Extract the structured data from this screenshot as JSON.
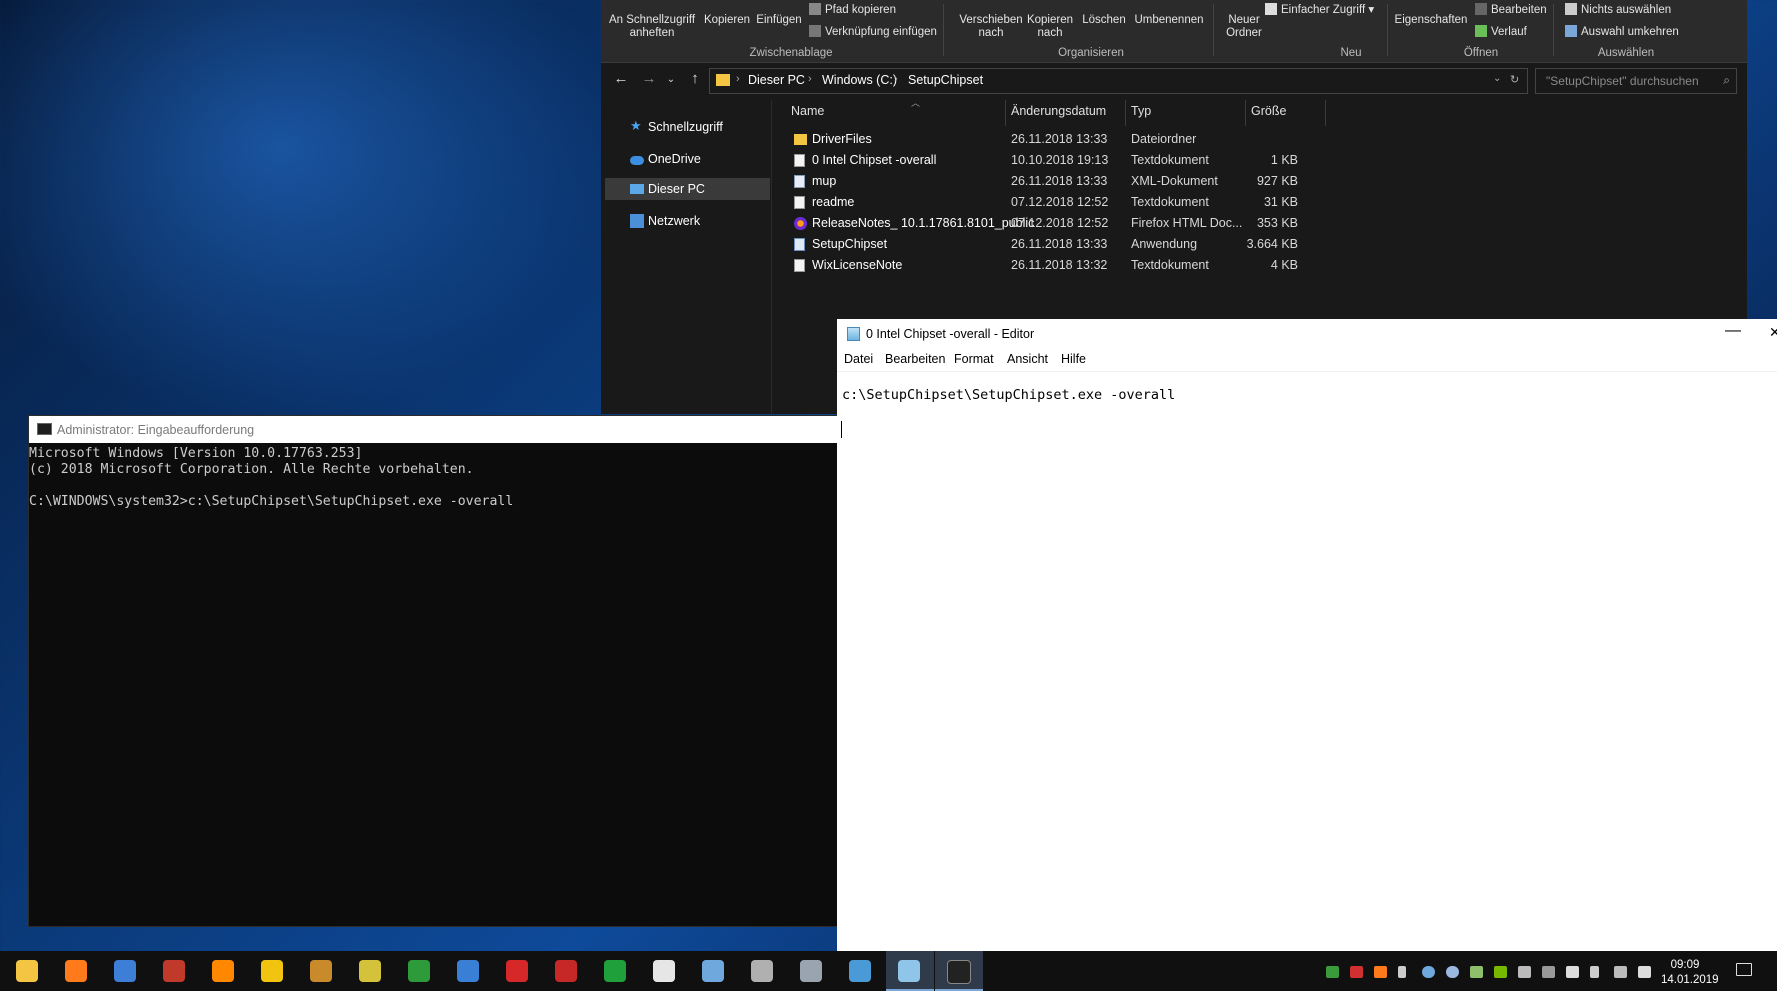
{
  "explorer": {
    "ribbon": {
      "pin_label_1": "An Schnellzugriff",
      "pin_label_2": "anheften",
      "copy": "Kopieren",
      "paste": "Einfügen",
      "copy_path": "Pfad kopieren",
      "paste_shortcut": "Verknüpfung einfügen",
      "move_to_1": "Verschieben",
      "move_to_2": "nach",
      "copy_to_1": "Kopieren",
      "copy_to_2": "nach",
      "delete": "Löschen",
      "rename": "Umbenennen",
      "new_folder_1": "Neuer",
      "new_folder_2": "Ordner",
      "easy_access": "Einfacher Zugriff",
      "properties": "Eigenschaften",
      "edit": "Bearbeiten",
      "history": "Verlauf",
      "select_none": "Nichts auswählen",
      "invert_selection": "Auswahl umkehren",
      "groups": {
        "clipboard": "Zwischenablage",
        "organize": "Organisieren",
        "new": "Neu",
        "open": "Öffnen",
        "select": "Auswählen"
      }
    },
    "breadcrumb": [
      "Dieser PC",
      "Windows (C:)",
      "SetupChipset"
    ],
    "search_placeholder": "\"SetupChipset\" durchsuchen",
    "nav_pane": [
      {
        "label": "Schnellzugriff",
        "icon": "star-icon"
      },
      {
        "label": "OneDrive",
        "icon": "cloud-icon"
      },
      {
        "label": "Dieser PC",
        "icon": "computer-icon",
        "selected": true
      },
      {
        "label": "Netzwerk",
        "icon": "network-icon"
      }
    ],
    "columns": {
      "name": "Name",
      "date": "Änderungsdatum",
      "type": "Typ",
      "size": "Größe"
    },
    "files": [
      {
        "name": "DriverFiles",
        "date": "26.11.2018 13:33",
        "type": "Dateiordner",
        "size": "",
        "icon": "folder"
      },
      {
        "name": "0 Intel Chipset -overall",
        "date": "10.10.2018 19:13",
        "type": "Textdokument",
        "size": "1 KB",
        "icon": "txt"
      },
      {
        "name": "mup",
        "date": "26.11.2018 13:33",
        "type": "XML-Dokument",
        "size": "927 KB",
        "icon": "xml"
      },
      {
        "name": "readme",
        "date": "07.12.2018 12:52",
        "type": "Textdokument",
        "size": "31 KB",
        "icon": "txt"
      },
      {
        "name": "ReleaseNotes_ 10.1.17861.8101_public",
        "date": "07.12.2018 12:52",
        "type": "Firefox HTML Doc...",
        "size": "353 KB",
        "icon": "ff"
      },
      {
        "name": "SetupChipset",
        "date": "26.11.2018 13:33",
        "type": "Anwendung",
        "size": "3.664 KB",
        "icon": "exe"
      },
      {
        "name": "WixLicenseNote",
        "date": "26.11.2018 13:32",
        "type": "Textdokument",
        "size": "4 KB",
        "icon": "txt"
      }
    ]
  },
  "cmd": {
    "title": "Administrator: Eingabeaufforderung",
    "lines": [
      "Microsoft Windows [Version 10.0.17763.253]",
      "(c) 2018 Microsoft Corporation. Alle Rechte vorbehalten.",
      "",
      "C:\\WINDOWS\\system32>c:\\SetupChipset\\SetupChipset.exe -overall"
    ]
  },
  "notepad": {
    "title": "0 Intel Chipset -overall - Editor",
    "menu": [
      "Datei",
      "Bearbeiten",
      "Format",
      "Ansicht",
      "Hilfe"
    ],
    "content": "c:\\SetupChipset\\SetupChipset.exe -overall"
  },
  "taskbar": {
    "apps": [
      {
        "name": "file-explorer-icon",
        "color": "#f4c542"
      },
      {
        "name": "firefox-icon",
        "color": "#ff7a1a"
      },
      {
        "name": "thunderbird-icon",
        "color": "#3d7fd6"
      },
      {
        "name": "tv-app-icon",
        "color": "#c0392b"
      },
      {
        "name": "vlc-icon",
        "color": "#ff8800"
      },
      {
        "name": "warning-app-icon",
        "color": "#f1c40f"
      },
      {
        "name": "tool-app-icon",
        "color": "#c88a2a"
      },
      {
        "name": "notes-app-icon",
        "color": "#d4c23a"
      },
      {
        "name": "xbox-icon",
        "color": "#2e9b3a"
      },
      {
        "name": "hardware-monitor-icon",
        "color": "#3a7fd6"
      },
      {
        "name": "flash-app-icon",
        "color": "#d62828"
      },
      {
        "name": "aida64-icon",
        "color": "#c62828"
      },
      {
        "name": "green-app-icon",
        "color": "#1fa03a"
      },
      {
        "name": "settings-icon",
        "color": "#e6e6e6"
      },
      {
        "name": "remote-desktop-icon",
        "color": "#6fa8dc"
      },
      {
        "name": "clock-app-icon",
        "color": "#b0b0b0"
      },
      {
        "name": "device-manager-icon",
        "color": "#9aa4b0"
      },
      {
        "name": "network-app-icon",
        "color": "#4a9ad8"
      },
      {
        "name": "notepad-icon",
        "color": "#8fc5e8"
      },
      {
        "name": "cmd-icon",
        "color": "#222222"
      }
    ],
    "clock_time": "09:09",
    "clock_date": "14.01.2019"
  }
}
